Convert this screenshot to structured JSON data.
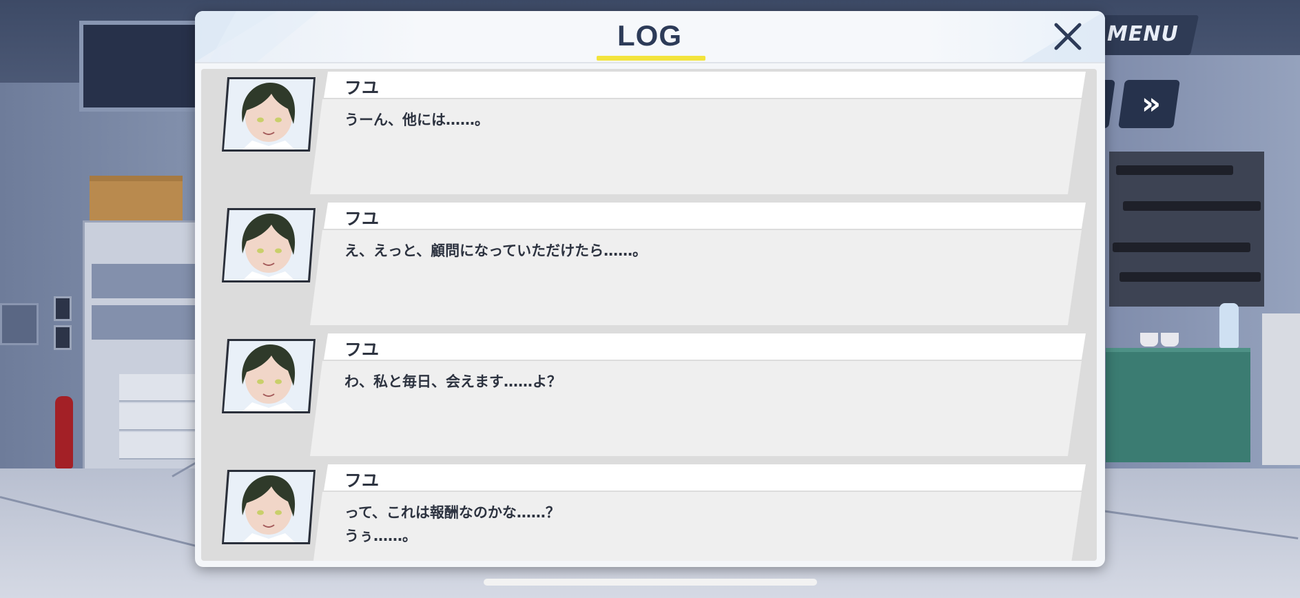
{
  "hud": {
    "menu_label": "MENU",
    "skip_icon": "fast-forward-icon"
  },
  "log": {
    "title": "LOG",
    "close_icon": "close-icon",
    "accent_color": "#f3e43c",
    "entries": [
      {
        "speaker": "フユ",
        "lines": [
          "うーん、他には……。"
        ]
      },
      {
        "speaker": "フユ",
        "lines": [
          "え、えっと、顧問になっていただけたら……。"
        ]
      },
      {
        "speaker": "フユ",
        "lines": [
          "わ、私と毎日、会えます……よ？"
        ]
      },
      {
        "speaker": "フユ",
        "lines": [
          "って、これは報酬なのかな……？",
          "うぅ……。"
        ]
      }
    ]
  },
  "colors": {
    "modal_bg": "#f4f6f9",
    "title_text": "#2d3b58",
    "list_bg": "#dcdcdc",
    "bubble_header": "#ffffff",
    "bubble_body": "#efefef"
  }
}
